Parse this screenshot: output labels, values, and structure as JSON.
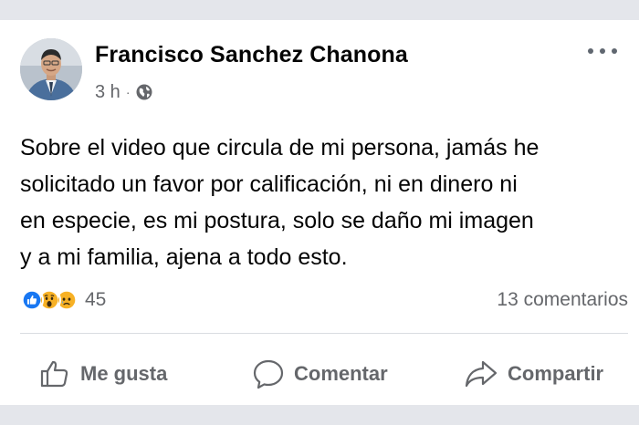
{
  "post": {
    "author": "Francisco Sanchez Chanona",
    "time": "3 h",
    "separator": "·",
    "privacy_icon": "globe-icon",
    "text": "Sobre el video que circula de mi persona, jamás he\nsolicitado un favor por calificación, ni en dinero ni\nen especie, es mi postura, solo se daño mi imagen\ny a mi familia, ajena a todo esto."
  },
  "reactions": {
    "types": [
      "like",
      "wow",
      "sad"
    ],
    "count": "45",
    "comments": "13 comentarios"
  },
  "actions": {
    "like": "Me gusta",
    "comment": "Comentar",
    "share": "Compartir"
  },
  "colors": {
    "like_blue": "#1877f2",
    "emoji_yellow": "#f7b125",
    "secondary_text": "#65676b"
  }
}
